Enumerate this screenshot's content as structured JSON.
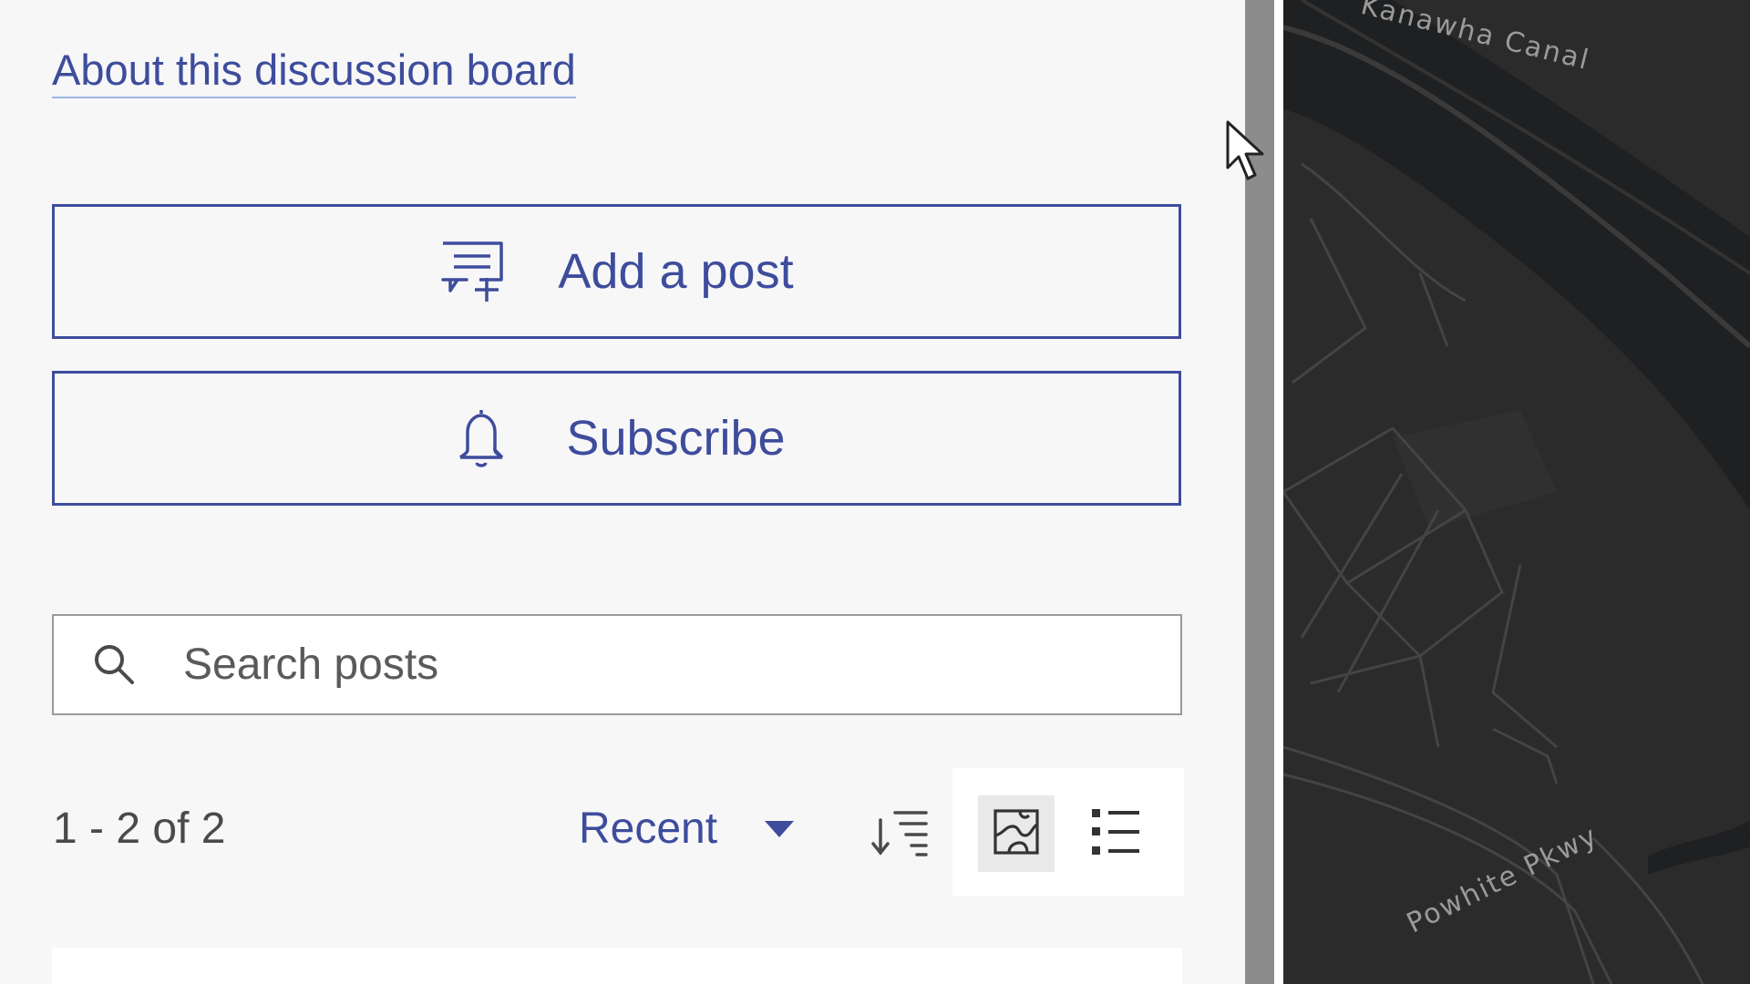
{
  "about_link": "About this discussion board",
  "buttons": {
    "add_post": "Add a post",
    "subscribe": "Subscribe"
  },
  "search": {
    "placeholder": "Search posts"
  },
  "results": {
    "count": "1 - 2 of 2",
    "sort_label": "Recent"
  },
  "map": {
    "labels": {
      "canal": "Kanawha Canal",
      "parkway": "Powhite Pkwy"
    }
  },
  "colors": {
    "accent": "#3e4c9c",
    "panel_bg": "#f7f7f8",
    "map_bg": "#2b2b2c"
  },
  "icons": {
    "add_post": "comment-plus-icon",
    "subscribe": "bell-icon",
    "search": "search-icon",
    "sort_caret": "caret-down-icon",
    "sort_order": "sort-descending-icon",
    "map_view": "map-view-icon",
    "list_view": "list-view-icon"
  }
}
